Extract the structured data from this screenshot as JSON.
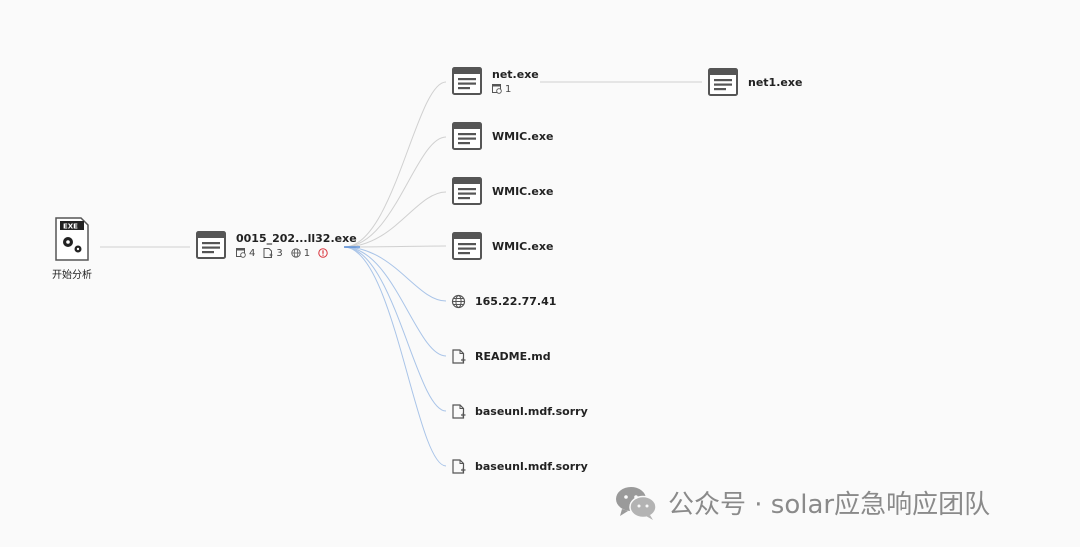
{
  "root": {
    "badge": "EXE",
    "label": "开始分析"
  },
  "main_process": {
    "name": "0015_202...ll32.exe",
    "process_count": "4",
    "file_count": "3",
    "network_count": "1"
  },
  "children": [
    {
      "type": "process",
      "name": "net.exe",
      "sub_count": "1"
    },
    {
      "type": "process",
      "name": "WMIC.exe"
    },
    {
      "type": "process",
      "name": "WMIC.exe"
    },
    {
      "type": "process",
      "name": "WMIC.exe"
    },
    {
      "type": "network",
      "name": "165.22.77.41"
    },
    {
      "type": "file",
      "name": "README.md"
    },
    {
      "type": "file",
      "name": "baseunl.mdf.sorry"
    },
    {
      "type": "file",
      "name": "baseunl.mdf.sorry"
    }
  ],
  "grandchild": {
    "type": "process",
    "name": "net1.exe"
  },
  "watermark": {
    "text": "公众号 · solar应急响应团队"
  },
  "colors": {
    "edge": "#d0d0d0",
    "edge_blue": "#a9c4e8",
    "icon": "#555555",
    "warning": "#d9363e"
  }
}
